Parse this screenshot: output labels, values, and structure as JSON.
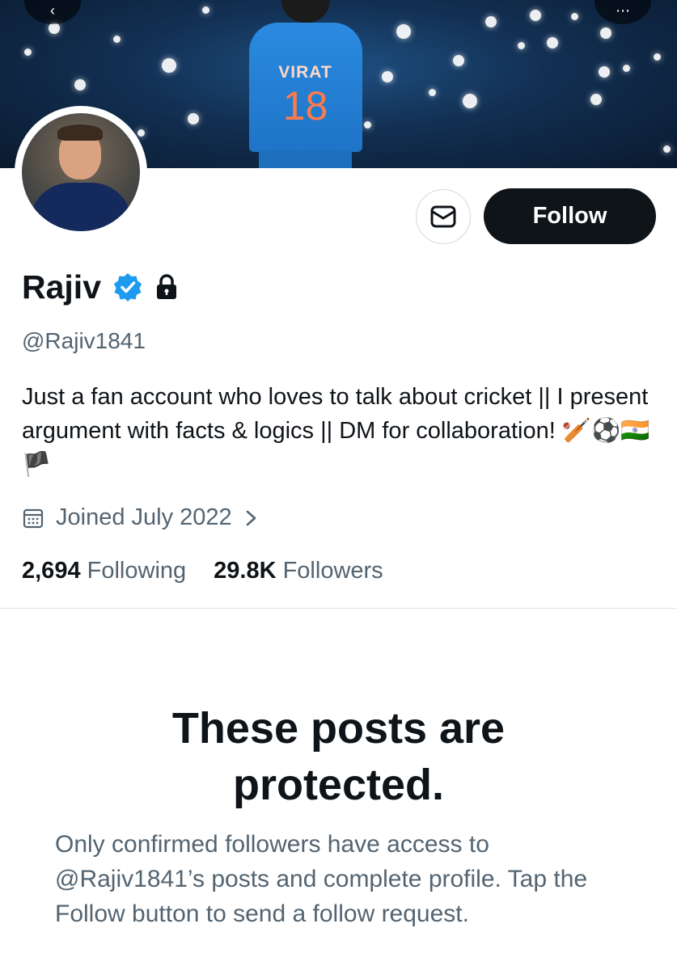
{
  "profile": {
    "display_name": "Rajiv",
    "handle": "@Rajiv1841",
    "bio": "Just a fan account who loves to talk about cricket || I present argument with facts & logics || DM for collaboration! 🏏⚽🇮🇳🏴",
    "joined": "Joined July 2022",
    "following_count": "2,694",
    "following_label": "Following",
    "followers_count": "29.8K",
    "followers_label": "Followers"
  },
  "banner": {
    "jersey_name": "VIRAT",
    "jersey_number": "18"
  },
  "actions": {
    "follow_label": "Follow"
  },
  "protected": {
    "title": "These posts are protected.",
    "message": "Only confirmed followers have access to @Rajiv1841’s posts and complete profile. Tap the Follow button to send a follow request."
  },
  "colors": {
    "verified": "#1d9bf0",
    "follow_bg": "#0f1419",
    "secondary_text": "#536471"
  },
  "icons": [
    "back-icon",
    "more-icon",
    "mail-icon",
    "verified-badge-icon",
    "lock-icon",
    "calendar-icon",
    "chevron-right-icon"
  ]
}
